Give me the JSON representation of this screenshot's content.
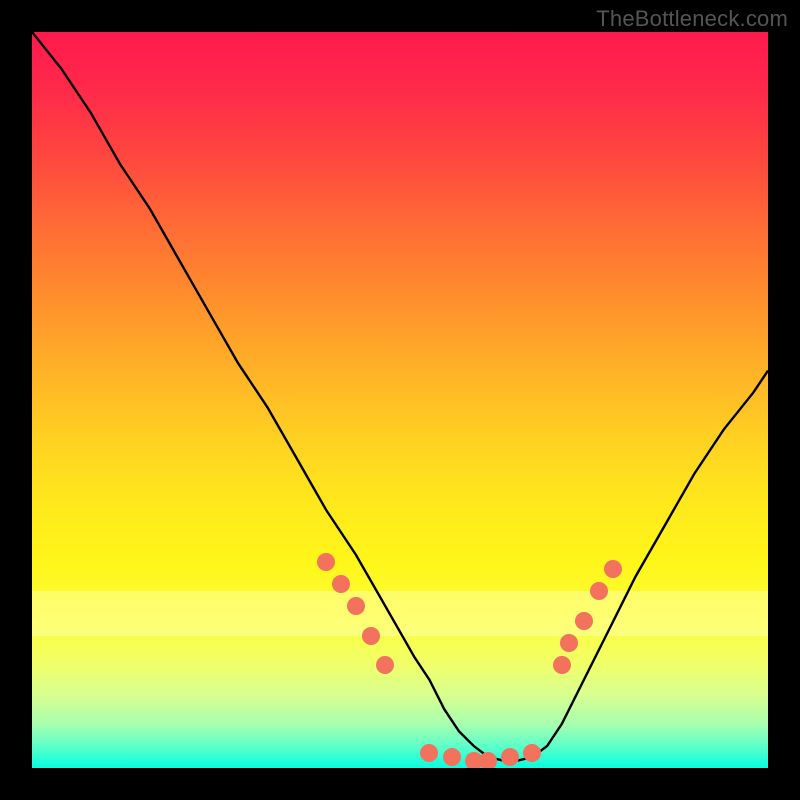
{
  "watermark": "TheBottleneck.com",
  "chart_data": {
    "type": "line",
    "title": "",
    "xlabel": "",
    "ylabel": "",
    "ylim": [
      0,
      100
    ],
    "xlim": [
      0,
      100
    ],
    "x": [
      0,
      4,
      8,
      12,
      16,
      20,
      24,
      28,
      32,
      36,
      40,
      44,
      48,
      52,
      54,
      56,
      58,
      60,
      62,
      64,
      66,
      68,
      70,
      72,
      74,
      78,
      82,
      86,
      90,
      94,
      98,
      100
    ],
    "values": [
      100,
      95,
      89,
      82,
      76,
      69,
      62,
      55,
      49,
      42,
      35,
      29,
      22,
      15,
      12,
      8,
      5,
      3,
      1.5,
      1,
      1,
      1.5,
      3,
      6,
      10,
      18,
      26,
      33,
      40,
      46,
      51,
      54
    ],
    "gradient_stops": [
      {
        "p": 0,
        "c": "#ff1a4d"
      },
      {
        "p": 8,
        "c": "#ff2a4a"
      },
      {
        "p": 17,
        "c": "#ff473f"
      },
      {
        "p": 26,
        "c": "#ff6a36"
      },
      {
        "p": 35,
        "c": "#ff8a2e"
      },
      {
        "p": 44,
        "c": "#ffab28"
      },
      {
        "p": 55,
        "c": "#ffd022"
      },
      {
        "p": 64,
        "c": "#ffe81c"
      },
      {
        "p": 72,
        "c": "#fff61a"
      },
      {
        "p": 80,
        "c": "#fdff3a"
      },
      {
        "p": 86,
        "c": "#f0ff6a"
      },
      {
        "p": 90,
        "c": "#d8ff8f"
      },
      {
        "p": 94,
        "c": "#a8ffaf"
      },
      {
        "p": 97,
        "c": "#5effc8"
      },
      {
        "p": 100,
        "c": "#08ffe0"
      }
    ],
    "markers": [
      {
        "x": 40,
        "y": 28
      },
      {
        "x": 42,
        "y": 25
      },
      {
        "x": 44,
        "y": 22
      },
      {
        "x": 46,
        "y": 18
      },
      {
        "x": 48,
        "y": 14
      },
      {
        "x": 54,
        "y": 2
      },
      {
        "x": 57,
        "y": 1.5
      },
      {
        "x": 60,
        "y": 1
      },
      {
        "x": 62,
        "y": 1
      },
      {
        "x": 65,
        "y": 1.5
      },
      {
        "x": 68,
        "y": 2
      },
      {
        "x": 72,
        "y": 14
      },
      {
        "x": 73,
        "y": 17
      },
      {
        "x": 75,
        "y": 20
      },
      {
        "x": 77,
        "y": 24
      },
      {
        "x": 79,
        "y": 27
      }
    ]
  }
}
